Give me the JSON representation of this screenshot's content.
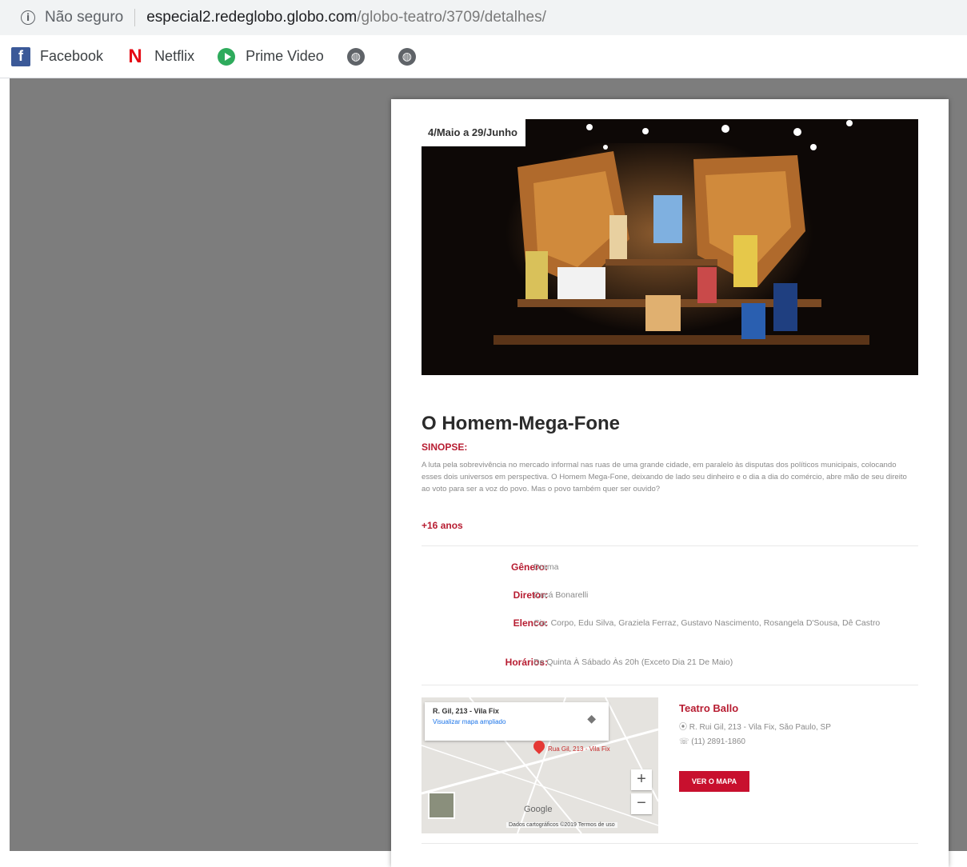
{
  "browser": {
    "security_label": "Não seguro",
    "url_host": "especial2.redeglobo.globo.com",
    "url_path": "/globo-teatro/3709/detalhes/"
  },
  "bookmarks": [
    {
      "label": "Facebook",
      "icon": "facebook-icon"
    },
    {
      "label": "Netflix",
      "icon": "netflix-icon"
    },
    {
      "label": "Prime Video",
      "icon": "prime-video-icon"
    },
    {
      "label": "",
      "icon": "globe-icon"
    },
    {
      "label": "",
      "icon": "globe-icon"
    }
  ],
  "show": {
    "date_range": "4/Maio a 29/Junho",
    "title": "O Homem-Mega-Fone",
    "synopsis_label": "SINOPSE:",
    "synopsis": "A luta pela sobrevivência no mercado informal nas ruas de uma grande cidade, em paralelo às disputas dos políticos municipais, colocando esses dois universos em perspectiva. O Homem Mega-Fone, deixando de lado seu dinheiro e o dia a dia do comércio, abre mão de seu direito ao voto para ser a voz do povo. Mas o povo também quer ser ouvido?",
    "rating": "+16 anos"
  },
  "details": [
    {
      "label": "Gênero:",
      "value": "Drama"
    },
    {
      "label": "Diretor:",
      "value": "Cacá Bonarelli"
    },
    {
      "label": "Elenco:",
      "value": "Cia. Corpo, Edu Silva, Graziela Ferraz, Gustavo Nascimento, Rosangela D'Sousa, Dê Castro"
    },
    {
      "label": "Horários:",
      "value": "De Quinta À Sábado Às 20h (Exceto Dia 21 De Maio)"
    }
  ],
  "venue": {
    "name": "Teatro Ballo",
    "address": "R. Rui Gil, 213 - Vila Fix, São Paulo, SP",
    "phone": "(11) 2891-1860",
    "map_button": "VER O MAPA",
    "map_popup_address": "R. Gil, 213 - Vila Fix",
    "map_popup_link": "Visualizar mapa ampliado",
    "map_pin_label": "Rua Gil, 213 - Vila Fix",
    "map_attribution": "Dados cartográficos ©2019   Termos de uso",
    "map_logo": "Google"
  },
  "colors": {
    "accent": "#b71c31",
    "button": "#c8102e",
    "overlay": "#7d7d7d"
  }
}
